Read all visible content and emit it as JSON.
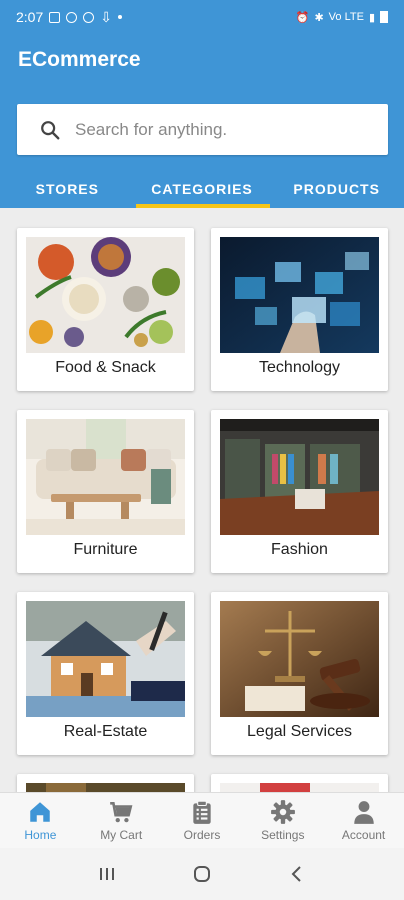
{
  "status_bar": {
    "time": "2:07",
    "right_text": "Vo LTE"
  },
  "app": {
    "title": "ECommerce"
  },
  "search": {
    "placeholder": "Search for anything."
  },
  "tabs": [
    {
      "label": "STORES"
    },
    {
      "label": "CATEGORIES",
      "active": true
    },
    {
      "label": "PRODUCTS"
    }
  ],
  "categories": [
    {
      "label": "Food & Snack"
    },
    {
      "label": "Technology"
    },
    {
      "label": "Furniture"
    },
    {
      "label": "Fashion"
    },
    {
      "label": "Real-Estate"
    },
    {
      "label": "Legal Services"
    }
  ],
  "bottom_nav": [
    {
      "label": "Home",
      "active": true
    },
    {
      "label": "My Cart"
    },
    {
      "label": "Orders"
    },
    {
      "label": "Settings"
    },
    {
      "label": "Account"
    }
  ],
  "colors": {
    "primary": "#3f95d6",
    "indicator": "#f5c518",
    "inactive": "#777777"
  }
}
